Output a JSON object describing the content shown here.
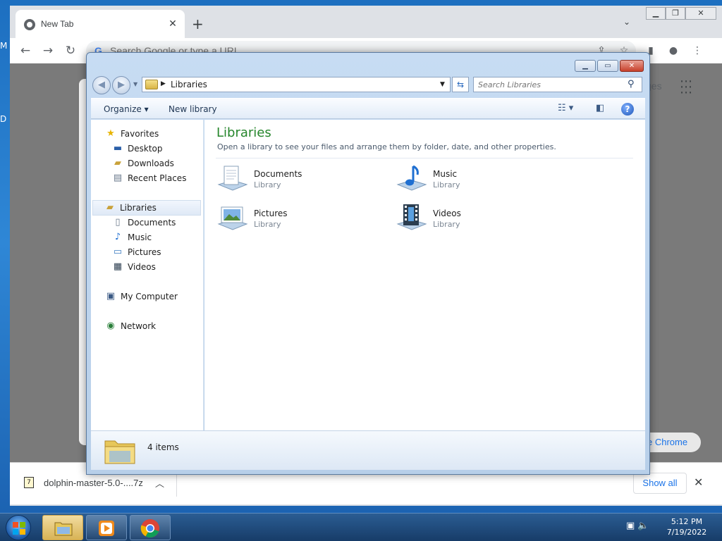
{
  "desktop": {
    "frag_top": "M",
    "frag_mid": "D"
  },
  "chrome": {
    "tab_title": "New Tab",
    "tab_close": "✕",
    "new_tab": "+",
    "omnibox_g": "G",
    "omnibox_placeholder": "Search Google or type a URL",
    "ntp_right_text": "ges",
    "customize_label": "e Chrome",
    "download": {
      "filename": "dolphin-master-5.0-....7z",
      "show_all": "Show all"
    }
  },
  "explorer": {
    "breadcrumb": "Libraries",
    "search_placeholder": "Search Libraries",
    "toolbar": {
      "organize": "Organize ▾",
      "new_library": "New library"
    },
    "nav": {
      "favorites": "Favorites",
      "desktop": "Desktop",
      "downloads": "Downloads",
      "recent_places": "Recent Places",
      "libraries": "Libraries",
      "documents": "Documents",
      "music": "Music",
      "pictures": "Pictures",
      "videos": "Videos",
      "my_computer": "My Computer",
      "network": "Network"
    },
    "content": {
      "title": "Libraries",
      "subtitle": "Open a library to see your files and arrange them by folder, date, and other properties.",
      "libraries": [
        {
          "name": "Documents",
          "type": "Library"
        },
        {
          "name": "Music",
          "type": "Library"
        },
        {
          "name": "Pictures",
          "type": "Library"
        },
        {
          "name": "Videos",
          "type": "Library"
        }
      ]
    },
    "status": {
      "count": "4 items"
    }
  },
  "taskbar": {
    "time": "5:12 PM",
    "date": "7/19/2022"
  },
  "colors": {
    "library_title": "#26862c",
    "chrome_link": "#1a73e8"
  },
  "icons": [
    "chrome-icon",
    "folder-icon",
    "star-icon",
    "music-note-icon",
    "film-icon",
    "computer-icon",
    "network-icon",
    "help-icon"
  ]
}
